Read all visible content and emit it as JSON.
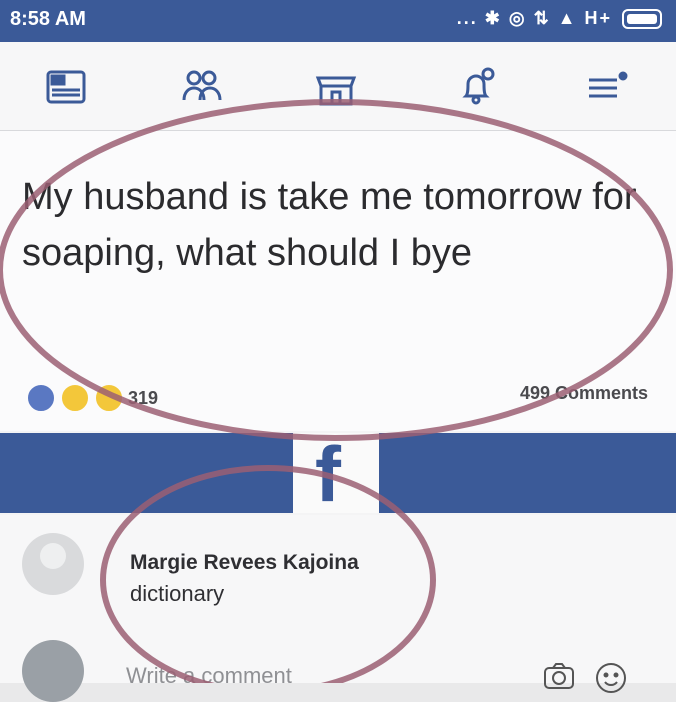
{
  "status_bar": {
    "time": "8:58 AM",
    "indicators": "... ✱ ◎ ⇅ ▲ H+"
  },
  "nav": {
    "icons": [
      "news-feed-icon",
      "friends-icon",
      "marketplace-icon",
      "notifications-icon",
      "menu-icon"
    ]
  },
  "post": {
    "text": "My husband is take me tomorrow for soaping, what should I bye",
    "reaction_count": "319",
    "comments_count": "499 Comments"
  },
  "comment": {
    "author": "Margie Revees Kajoina",
    "body": "dictionary"
  },
  "composer": {
    "placeholder": "Write a comment"
  },
  "colors": {
    "brand": "#3b5a98",
    "circle": "#9b5f73"
  }
}
